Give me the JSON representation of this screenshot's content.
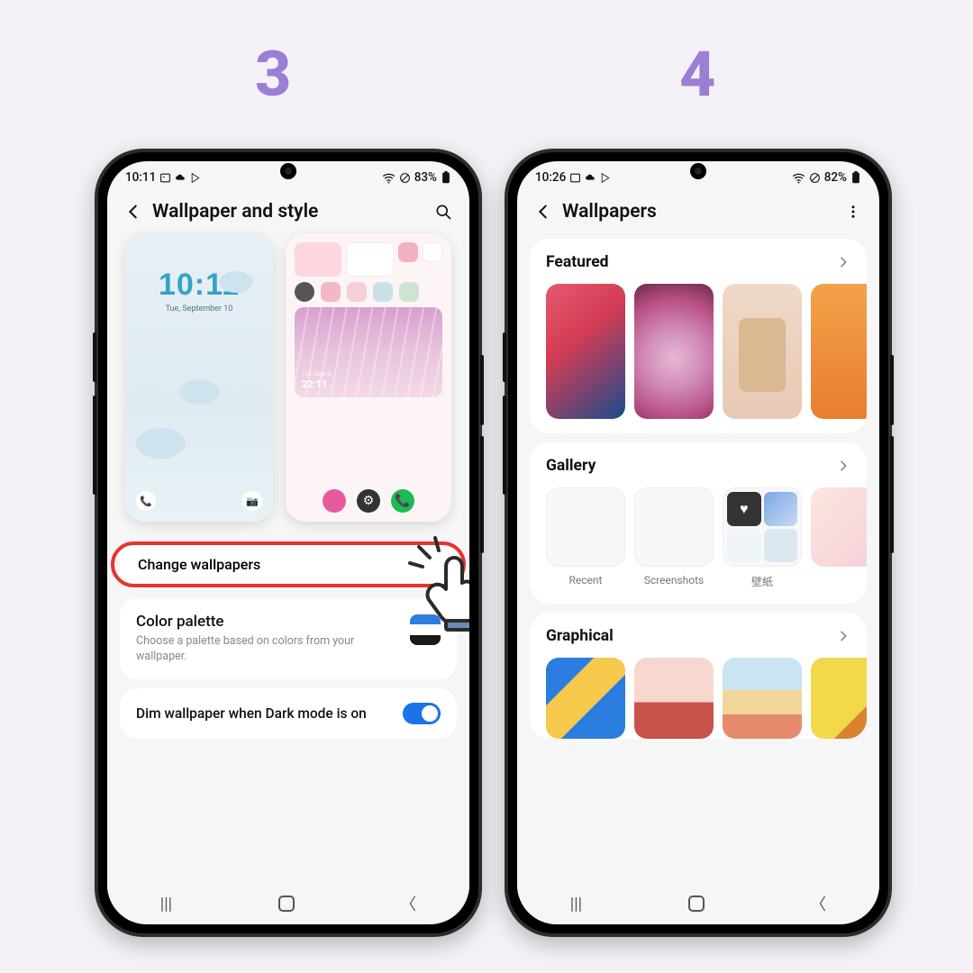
{
  "steps": {
    "s3": "3",
    "s4": "4"
  },
  "phone1": {
    "status": {
      "time": "10:11",
      "battery": "83%"
    },
    "header": {
      "title": "Wallpaper and style"
    },
    "lock_preview": {
      "time": "10:11",
      "date": "Tue, September 10"
    },
    "home_preview": {
      "photo_time": "22:11",
      "photo_date": "TUE, Sept10"
    },
    "change_wp": "Change wallpapers",
    "palette": {
      "title": "Color palette",
      "sub": "Choose a palette based on colors from your wallpaper."
    },
    "dim": "Dim wallpaper when Dark mode is on"
  },
  "phone2": {
    "status": {
      "time": "10:26",
      "battery": "82%"
    },
    "header": {
      "title": "Wallpapers"
    },
    "featured": "Featured",
    "gallery": {
      "title": "Gallery",
      "items": [
        "Recent",
        "Screenshots",
        "壁紙"
      ]
    },
    "graphical": "Graphical"
  }
}
